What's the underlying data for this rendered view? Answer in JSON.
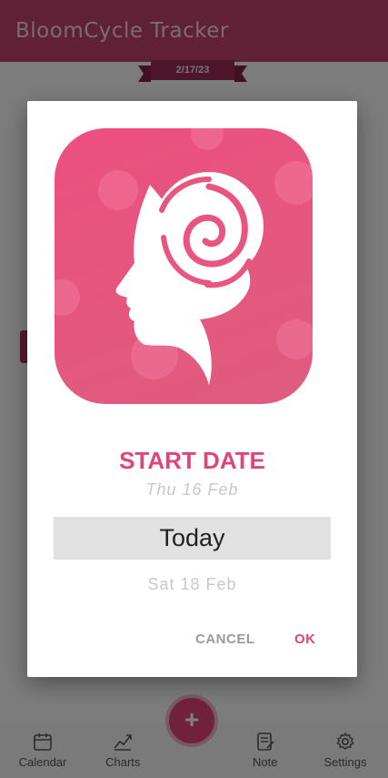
{
  "app": {
    "title": "BloomCycle Tracker",
    "current_date": "2/17/23",
    "colors": {
      "primary": "#c0416a",
      "accent": "#e0457a"
    }
  },
  "bottom_nav": {
    "items": [
      {
        "label": "Calendar",
        "icon": "calendar-icon"
      },
      {
        "label": "Charts",
        "icon": "chart-icon"
      },
      {
        "label": "Note",
        "icon": "note-icon"
      },
      {
        "label": "Settings",
        "icon": "gear-icon"
      }
    ],
    "fab_label": "+"
  },
  "dialog": {
    "logo_icon": "woman-rose-logo",
    "title": "START DATE",
    "picker": {
      "previous": "Thu 16 Feb",
      "selected": "Today",
      "next": "Sat 18 Feb"
    },
    "cancel_label": "CANCEL",
    "ok_label": "OK"
  }
}
